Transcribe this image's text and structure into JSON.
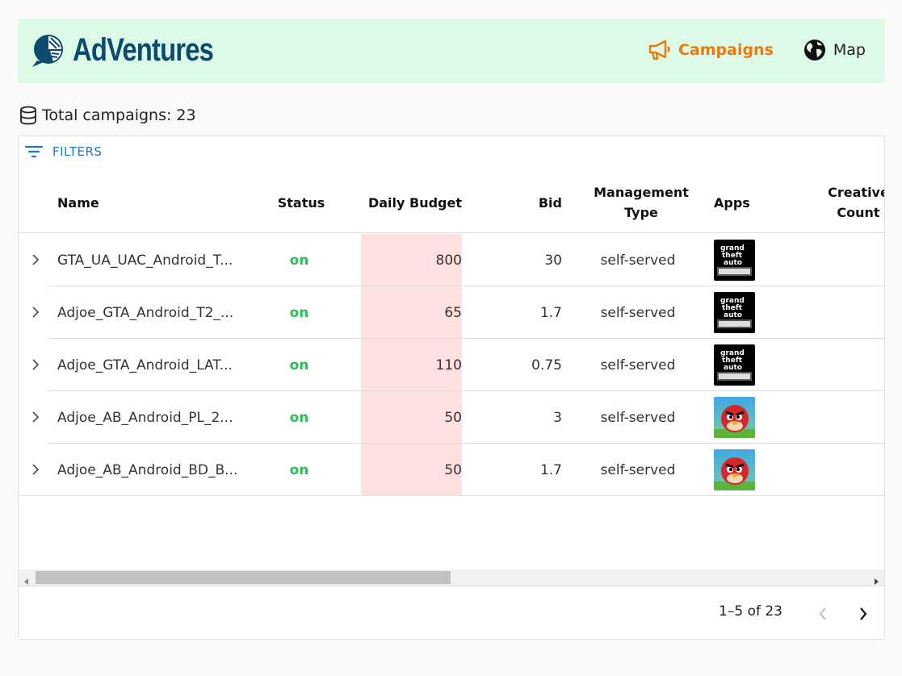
{
  "app": {
    "name": "AdVentures"
  },
  "nav": {
    "campaigns_label": "Campaigns",
    "map_label": "Map",
    "active": "Campaigns",
    "accent_color": "#ea7a0c"
  },
  "summary": {
    "total_label": "Total campaigns: 23"
  },
  "toolbar": {
    "filters_label": "FILTERS"
  },
  "table": {
    "columns": {
      "name": "Name",
      "status": "Status",
      "daily_budget": "Daily Budget",
      "bid": "Bid",
      "management_type_1": "Management",
      "management_type_2": "Type",
      "apps": "Apps",
      "creative_count_1": "Creative",
      "creative_count_2": "Count"
    },
    "rows": [
      {
        "name": "GTA_UA_UAC_Android_T...",
        "status": "on",
        "daily_budget": "800",
        "bid": "30",
        "management_type": "self-served",
        "app_icon": "gta-san-andreas-icon"
      },
      {
        "name": "Adjoe_GTA_Android_T2_...",
        "status": "on",
        "daily_budget": "65",
        "bid": "1.7",
        "management_type": "self-served",
        "app_icon": "gta-san-andreas-icon"
      },
      {
        "name": "Adjoe_GTA_Android_LAT...",
        "status": "on",
        "daily_budget": "110",
        "bid": "0.75",
        "management_type": "self-served",
        "app_icon": "gta-san-andreas-icon"
      },
      {
        "name": "Adjoe_AB_Android_PL_2...",
        "status": "on",
        "daily_budget": "50",
        "bid": "3",
        "management_type": "self-served",
        "app_icon": "angry-birds-icon"
      },
      {
        "name": "Adjoe_AB_Android_BD_B...",
        "status": "on",
        "daily_budget": "50",
        "bid": "1.7",
        "management_type": "self-served",
        "app_icon": "angry-birds-icon"
      }
    ]
  },
  "pagination": {
    "label": "1–5 of 23"
  },
  "colors": {
    "header_bg": "#dcfae6",
    "logo_blue": "#0c4a6e",
    "status_on": "#2ebd59",
    "budget_highlight": "#ffe0e0",
    "filters_blue": "#1976d2"
  }
}
